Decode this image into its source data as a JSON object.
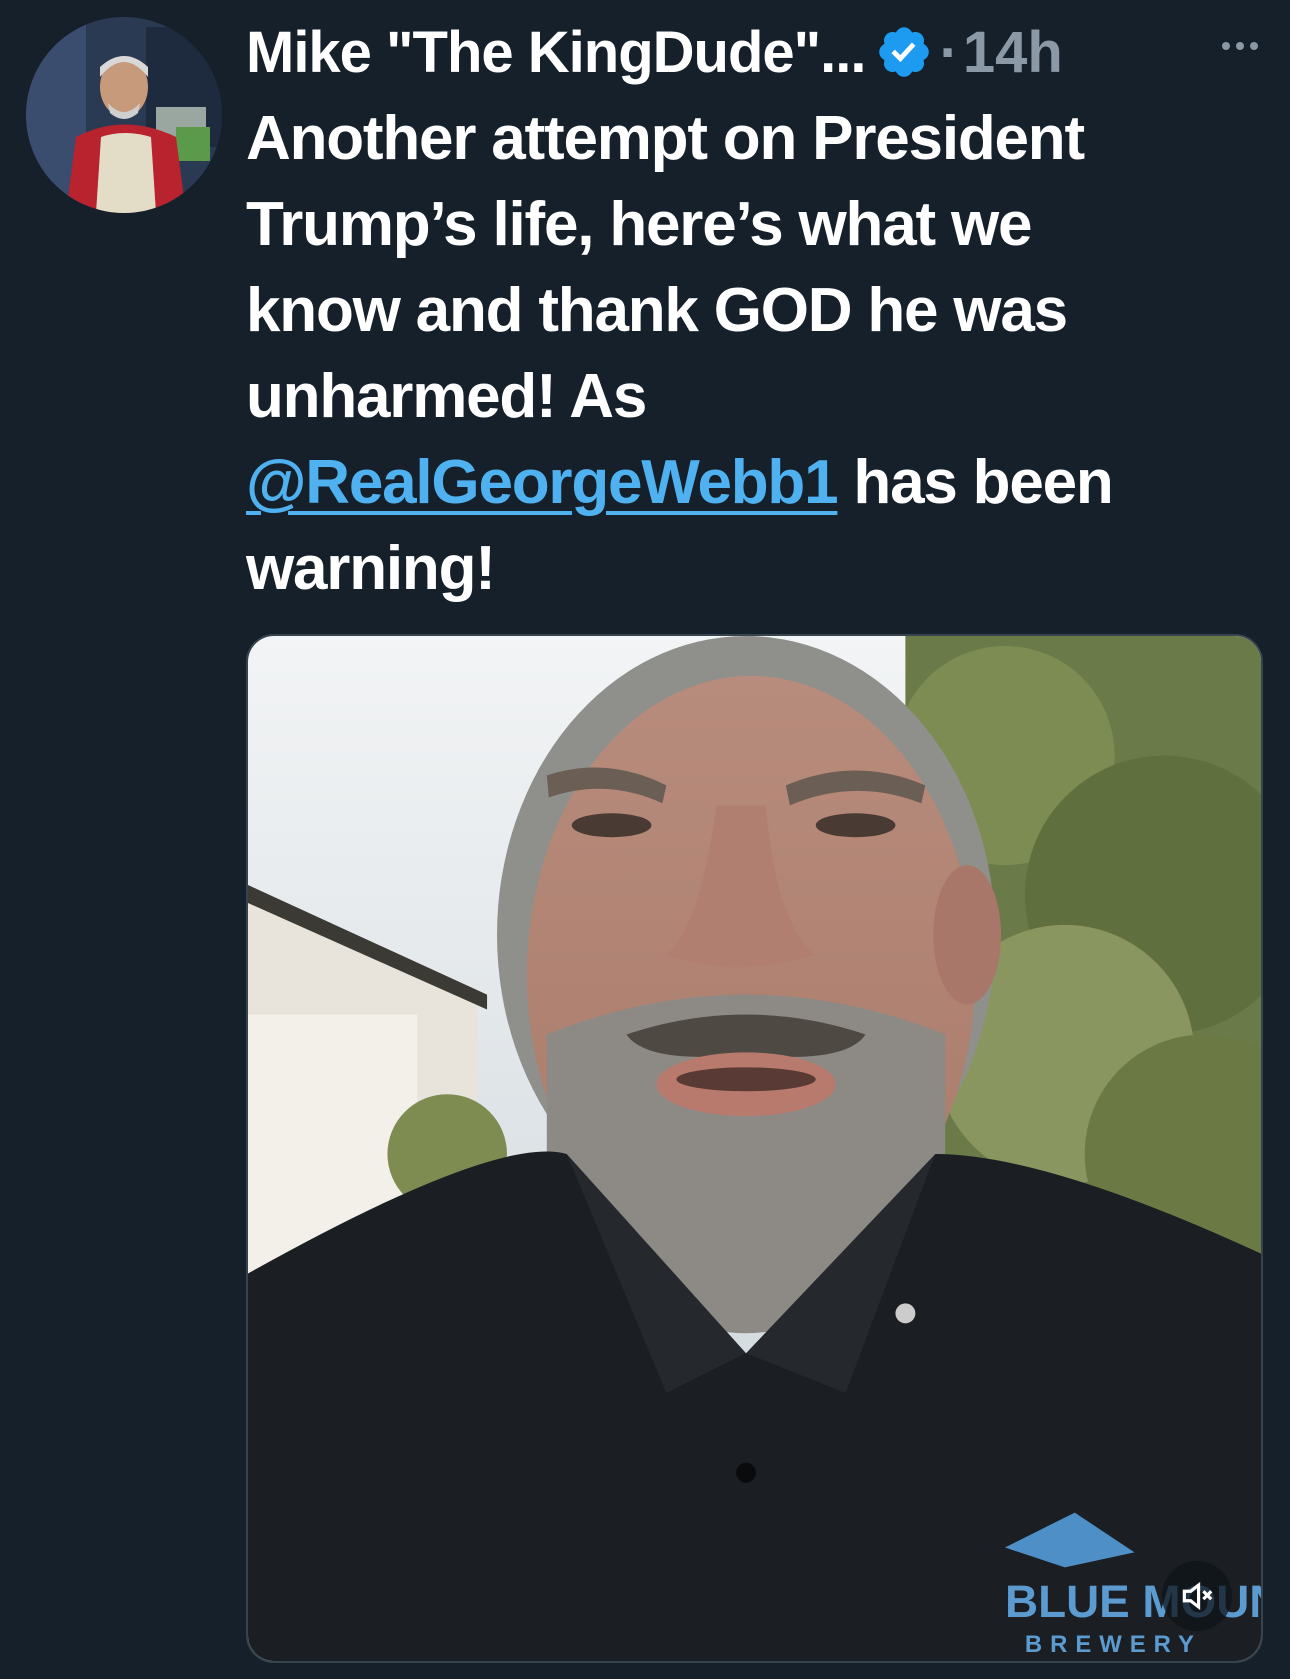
{
  "tweet": {
    "display_name": "Mike \"The KingDude\"...",
    "verified": true,
    "separator": "·",
    "timestamp": "14h",
    "text_lines": [
      "Another attempt on President",
      "Trump’s life, here’s what we",
      "know and thank GOD he was",
      "unharmed! As"
    ],
    "mention": "@RealGeorgeWebb1",
    "text_after_mention": " has been",
    "text_last_line": "warning!",
    "media": {
      "type": "video",
      "muted": true,
      "shirt_logo_text": "BLUE MOUNTAIN BREWERY"
    }
  },
  "colors": {
    "background": "#15202b",
    "text": "#ffffff",
    "secondary": "#8b98a5",
    "link": "#50b1f0",
    "verified": "#1d9bf0"
  },
  "icons": {
    "verified": "verified-badge-icon",
    "more": "more-horizontal-icon",
    "mute": "volume-muted-icon"
  }
}
